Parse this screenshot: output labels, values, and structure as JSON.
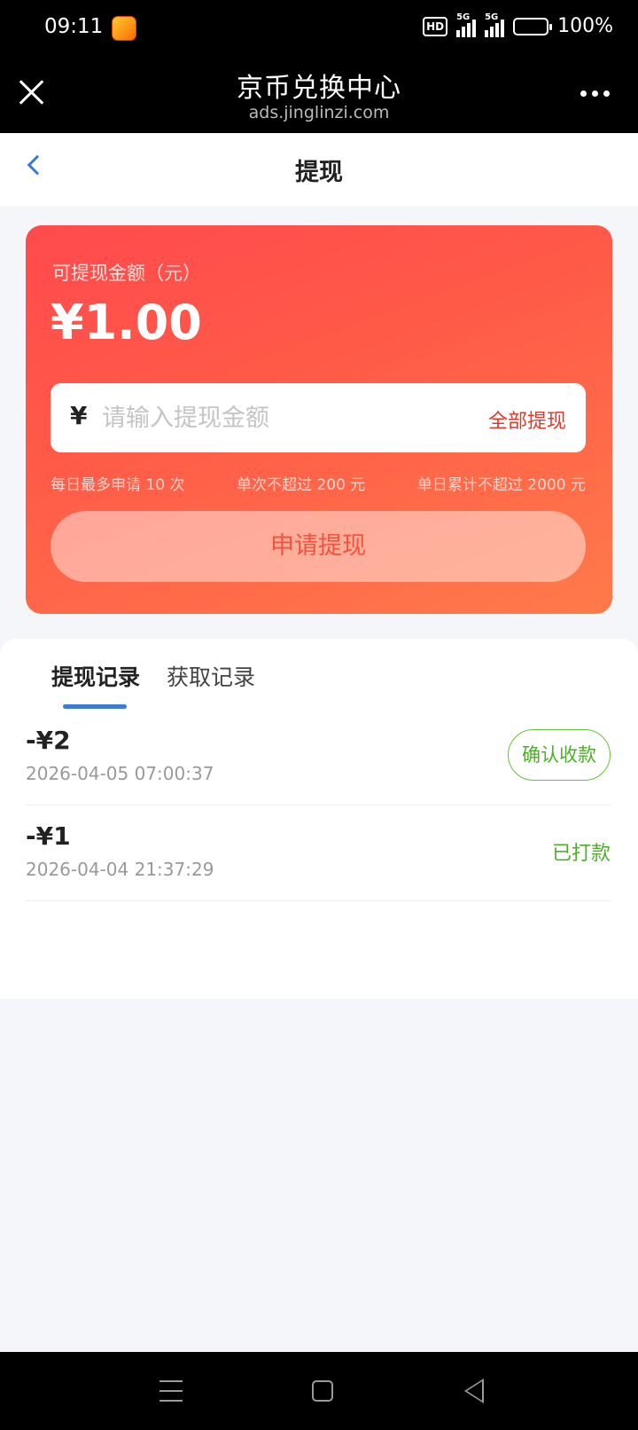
{
  "status_bar": {
    "time": "09:11",
    "hd_label": "HD",
    "sim1_label": "5G",
    "sim2_label": "5G",
    "battery": "100%"
  },
  "browser": {
    "title": "京币兑换中心",
    "url": "ads.jinglinzi.com"
  },
  "page": {
    "title": "提现"
  },
  "withdraw_card": {
    "label": "可提现金额（元）",
    "amount": "¥1.00",
    "currency_symbol": "¥",
    "input_placeholder": "请输入提现金额",
    "withdraw_all": "全部提现",
    "limits": [
      "每日最多申请 10 次",
      "单次不超过 200 元",
      "单日累计不超过 2000 元"
    ],
    "apply_button": "申请提现",
    "colors": {
      "gradient_start": "#ff4a4d",
      "gradient_end": "#ff7a4a"
    }
  },
  "records": {
    "tabs": [
      {
        "label": "提现记录",
        "active": true
      },
      {
        "label": "获取记录",
        "active": false
      }
    ],
    "items": [
      {
        "amount": "-¥2",
        "datetime": "2026-04-05 07:00:37",
        "action": "确认收款"
      },
      {
        "amount": "-¥1",
        "datetime": "2026-04-04 21:37:29",
        "status": "已打款"
      }
    ]
  }
}
